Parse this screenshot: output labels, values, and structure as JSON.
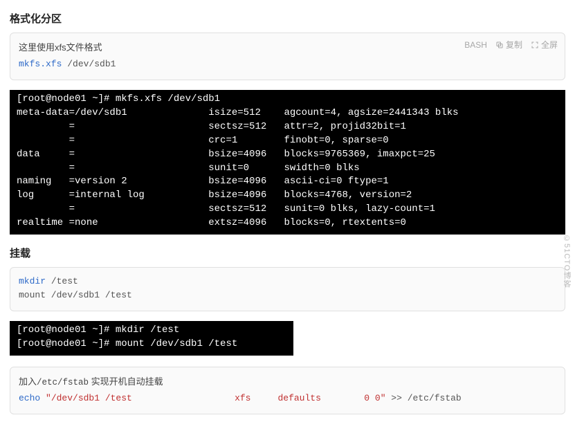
{
  "h1": "格式化分区",
  "card1": {
    "note": "这里使用xfs文件格式",
    "lang": "BASH",
    "copy": "复制",
    "full": "全屏",
    "code_cmd": "mkfs.xfs",
    "code_arg": " /dev/sdb1"
  },
  "term1": "[root@node01 ~]# mkfs.xfs /dev/sdb1\nmeta-data=/dev/sdb1              isize=512    agcount=4, agsize=2441343 blks\n         =                       sectsz=512   attr=2, projid32bit=1\n         =                       crc=1        finobt=0, sparse=0\ndata     =                       bsize=4096   blocks=9765369, imaxpct=25\n         =                       sunit=0      swidth=0 blks\nnaming   =version 2              bsize=4096   ascii-ci=0 ftype=1\nlog      =internal log           bsize=4096   blocks=4768, version=2\n         =                       sectsz=512   sunit=0 blks, lazy-count=1\nrealtime =none                   extsz=4096   blocks=0, rtextents=0",
  "h2": "挂载",
  "card2": {
    "l1a": "mkdir",
    "l1b": " /test",
    "l2": "mount /dev/sdb1 /test"
  },
  "term2": "[root@node01 ~]# mkdir /test\n[root@node01 ~]# mount /dev/sdb1 /test",
  "card3": {
    "note_pre": "加入",
    "note_code": "/etc/fstab",
    "note_post": " 实现开机自动挂载",
    "echo": "echo",
    "str": " \"/dev/sdb1 /test                   xfs     defaults        0 0\"",
    "tail": " >> /etc/fstab"
  },
  "watermark": "©51CTO博客"
}
